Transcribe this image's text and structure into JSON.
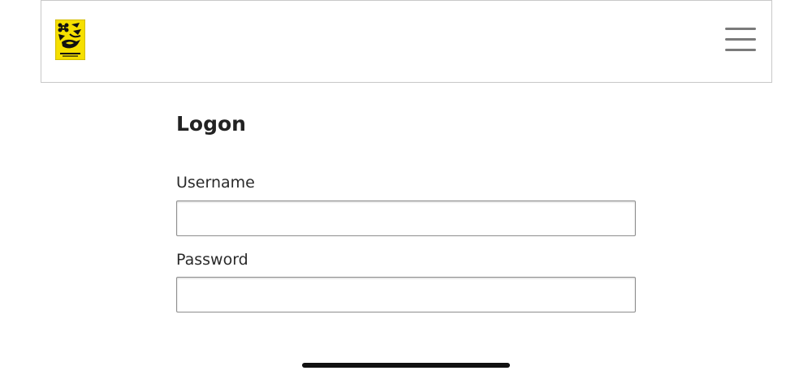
{
  "header": {
    "logo_icon": "organization-logo-icon",
    "logo_color": "#f2da00",
    "menu_icon": "hamburger-menu-icon"
  },
  "page": {
    "title": "Logon"
  },
  "form": {
    "username_label": "Username",
    "username_value": "",
    "password_label": "Password",
    "password_value": ""
  }
}
